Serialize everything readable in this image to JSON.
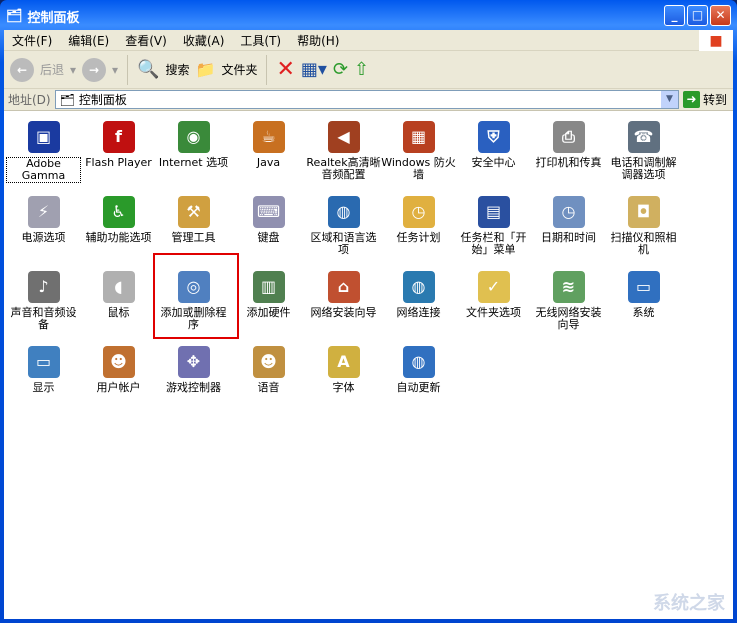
{
  "window": {
    "title": "控制面板"
  },
  "menu": [
    "文件(F)",
    "编辑(E)",
    "查看(V)",
    "收藏(A)",
    "工具(T)",
    "帮助(H)"
  ],
  "toolbar": {
    "back": "后退",
    "search": "搜索",
    "folders": "文件夹"
  },
  "address": {
    "label": "地址(D)",
    "value": "控制面板",
    "go": "转到"
  },
  "items": [
    {
      "label": "Adobe Gamma",
      "color": "#1a3aa0",
      "glyph": "▣"
    },
    {
      "label": "Flash Player",
      "color": "#c01010",
      "glyph": "f"
    },
    {
      "label": "Internet 选项",
      "color": "#3a8a3a",
      "glyph": "◉"
    },
    {
      "label": "Java",
      "color": "#c87020",
      "glyph": "☕"
    },
    {
      "label": "Realtek高清晰音频配置",
      "color": "#a04020",
      "glyph": "◀"
    },
    {
      "label": "Windows 防火墙",
      "color": "#b84020",
      "glyph": "▦"
    },
    {
      "label": "安全中心",
      "color": "#2a60c0",
      "glyph": "⛨"
    },
    {
      "label": "打印机和传真",
      "color": "#888888",
      "glyph": "⎙"
    },
    {
      "label": "电话和调制解调器选项",
      "color": "#607080",
      "glyph": "☎"
    },
    {
      "label": "电源选项",
      "color": "#a0a0b0",
      "glyph": "⚡"
    },
    {
      "label": "辅助功能选项",
      "color": "#2a9a2a",
      "glyph": "♿"
    },
    {
      "label": "管理工具",
      "color": "#d0a040",
      "glyph": "⚒"
    },
    {
      "label": "键盘",
      "color": "#9090b0",
      "glyph": "⌨"
    },
    {
      "label": "区域和语言选项",
      "color": "#2a6ab0",
      "glyph": "◍"
    },
    {
      "label": "任务计划",
      "color": "#e0b040",
      "glyph": "◷"
    },
    {
      "label": "任务栏和「开始」菜单",
      "color": "#2a50a0",
      "glyph": "▤"
    },
    {
      "label": "日期和时间",
      "color": "#7090c0",
      "glyph": "◷"
    },
    {
      "label": "扫描仪和照相机",
      "color": "#d0b060",
      "glyph": "◘"
    },
    {
      "label": "声音和音频设备",
      "color": "#707070",
      "glyph": "♪"
    },
    {
      "label": "鼠标",
      "color": "#b0b0b0",
      "glyph": "◖"
    },
    {
      "label": "添加或删除程序",
      "color": "#5080c0",
      "glyph": "◎"
    },
    {
      "label": "添加硬件",
      "color": "#508050",
      "glyph": "▥"
    },
    {
      "label": "网络安装向导",
      "color": "#c05030",
      "glyph": "⌂"
    },
    {
      "label": "网络连接",
      "color": "#2a7ab0",
      "glyph": "◍"
    },
    {
      "label": "文件夹选项",
      "color": "#e0c050",
      "glyph": "✓"
    },
    {
      "label": "无线网络安装向导",
      "color": "#60a060",
      "glyph": "≋"
    },
    {
      "label": "系统",
      "color": "#3070c0",
      "glyph": "▭"
    },
    {
      "label": "显示",
      "color": "#4080c0",
      "glyph": "▭"
    },
    {
      "label": "用户帐户",
      "color": "#c07030",
      "glyph": "☻"
    },
    {
      "label": "游戏控制器",
      "color": "#7070b0",
      "glyph": "✥"
    },
    {
      "label": "语音",
      "color": "#c09040",
      "glyph": "☻"
    },
    {
      "label": "字体",
      "color": "#d0b040",
      "glyph": "A"
    },
    {
      "label": "自动更新",
      "color": "#3070c0",
      "glyph": "◍"
    }
  ],
  "watermark": "系统之家"
}
